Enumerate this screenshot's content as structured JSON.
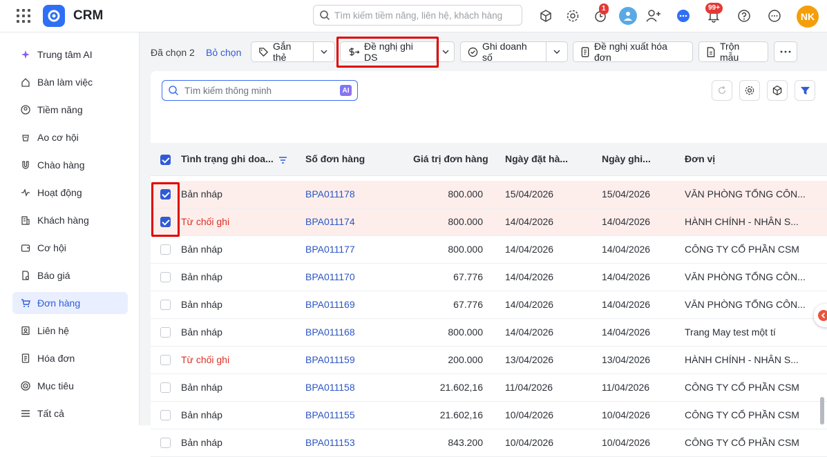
{
  "app": {
    "brand": "CRM"
  },
  "header": {
    "search_placeholder": "Tìm kiếm tiềm năng, liên hệ, khách hàng",
    "timer_badge": "1",
    "notif_badge": "99+",
    "user_initials": "NK"
  },
  "sidebar": {
    "items": [
      {
        "label": "Trung tâm AI",
        "icon": "sparkle-icon"
      },
      {
        "label": "Bàn làm việc",
        "icon": "home-icon"
      },
      {
        "label": "Tiềm năng",
        "icon": "lead-icon"
      },
      {
        "label": "Ao cơ hội",
        "icon": "pool-icon"
      },
      {
        "label": "Chào hàng",
        "icon": "magnet-icon"
      },
      {
        "label": "Hoạt động",
        "icon": "activity-icon"
      },
      {
        "label": "Khách hàng",
        "icon": "building-icon"
      },
      {
        "label": "Cơ hội",
        "icon": "wallet-icon"
      },
      {
        "label": "Báo giá",
        "icon": "quote-icon"
      },
      {
        "label": "Đơn hàng",
        "icon": "cart-icon"
      },
      {
        "label": "Liên hệ",
        "icon": "contact-icon"
      },
      {
        "label": "Hóa đơn",
        "icon": "invoice-icon"
      },
      {
        "label": "Mục tiêu",
        "icon": "target-icon"
      },
      {
        "label": "Tất cả",
        "icon": "menu-icon"
      }
    ],
    "active_index": 9
  },
  "actions": {
    "selected": "Đã chọn 2",
    "deselect": "Bỏ chọn",
    "tag": "Gắn thẻ",
    "propose_revenue": "Đề nghị ghi DS",
    "record_revenue": "Ghi doanh số",
    "propose_invoice": "Đề nghị xuất hóa đơn",
    "merge": "Trộn mẫu"
  },
  "toolbar": {
    "smart_search_placeholder": "Tìm kiếm thông minh",
    "ai_chip": "AI"
  },
  "table": {
    "columns": [
      "Tình trạng ghi doa...",
      "Số đơn hàng",
      "Giá trị đơn hàng",
      "Ngày đặt hà...",
      "Ngày ghi...",
      "Đơn vị"
    ],
    "rows": [
      {
        "checked": true,
        "status": "Bản nháp",
        "status_type": "draft",
        "order": "BPA011178",
        "value": "800.000",
        "order_date": "15/04/2026",
        "record_date": "15/04/2026",
        "unit": "VĂN PHÒNG TỔNG CÔN..."
      },
      {
        "checked": true,
        "status": "Từ chối ghi",
        "status_type": "rejected",
        "order": "BPA011174",
        "value": "800.000",
        "order_date": "14/04/2026",
        "record_date": "14/04/2026",
        "unit": "HÀNH CHÍNH - NHÂN S..."
      },
      {
        "checked": false,
        "status": "Bản nháp",
        "status_type": "draft",
        "order": "BPA011177",
        "value": "800.000",
        "order_date": "14/04/2026",
        "record_date": "14/04/2026",
        "unit": "CÔNG TY CỔ PHẦN CSM"
      },
      {
        "checked": false,
        "status": "Bản nháp",
        "status_type": "draft",
        "order": "BPA011170",
        "value": "67.776",
        "order_date": "14/04/2026",
        "record_date": "14/04/2026",
        "unit": "VĂN PHÒNG TỔNG CÔN..."
      },
      {
        "checked": false,
        "status": "Bản nháp",
        "status_type": "draft",
        "order": "BPA011169",
        "value": "67.776",
        "order_date": "14/04/2026",
        "record_date": "14/04/2026",
        "unit": "VĂN PHÒNG TỔNG CÔN..."
      },
      {
        "checked": false,
        "status": "Bản nháp",
        "status_type": "draft",
        "order": "BPA011168",
        "value": "800.000",
        "order_date": "14/04/2026",
        "record_date": "14/04/2026",
        "unit": "Trang May test một tí"
      },
      {
        "checked": false,
        "status": "Từ chối ghi",
        "status_type": "rejected",
        "order": "BPA011159",
        "value": "200.000",
        "order_date": "13/04/2026",
        "record_date": "13/04/2026",
        "unit": "HÀNH CHÍNH - NHÂN S..."
      },
      {
        "checked": false,
        "status": "Bản nháp",
        "status_type": "draft",
        "order": "BPA011158",
        "value": "21.602,16",
        "order_date": "11/04/2026",
        "record_date": "11/04/2026",
        "unit": "CÔNG TY CỔ PHẦN CSM"
      },
      {
        "checked": false,
        "status": "Bản nháp",
        "status_type": "draft",
        "order": "BPA011155",
        "value": "21.602,16",
        "order_date": "10/04/2026",
        "record_date": "10/04/2026",
        "unit": "CÔNG TY CỔ PHẦN CSM"
      },
      {
        "checked": false,
        "status": "Bản nháp",
        "status_type": "draft",
        "order": "BPA011153",
        "value": "843.200",
        "order_date": "10/04/2026",
        "record_date": "10/04/2026",
        "unit": "CÔNG TY CỔ PHẦN CSM"
      }
    ]
  },
  "colors": {
    "accent": "#2f5bd6",
    "link": "#2a55c4",
    "rejected": "#d93025",
    "highlight": "#e00000",
    "selected_row": "#fdeeeb"
  }
}
